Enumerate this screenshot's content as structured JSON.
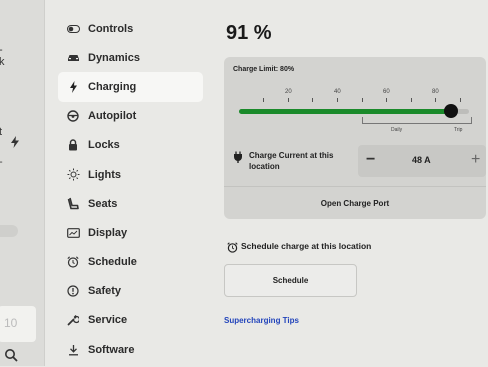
{
  "left_strip": {
    "frag1": "-",
    "frag2": "k",
    "frag3": "t",
    "frag4": "-",
    "tile_text": "10"
  },
  "menu": [
    {
      "label": "Controls",
      "icon": "toggle-icon",
      "active": false
    },
    {
      "label": "Dynamics",
      "icon": "car-icon",
      "active": false
    },
    {
      "label": "Charging",
      "icon": "bolt-icon",
      "active": true
    },
    {
      "label": "Autopilot",
      "icon": "steering-wheel-icon",
      "active": false
    },
    {
      "label": "Locks",
      "icon": "lock-icon",
      "active": false
    },
    {
      "label": "Lights",
      "icon": "sun-icon",
      "active": false
    },
    {
      "label": "Seats",
      "icon": "seat-icon",
      "active": false
    },
    {
      "label": "Display",
      "icon": "display-icon",
      "active": false
    },
    {
      "label": "Schedule",
      "icon": "alarm-clock-icon",
      "active": false
    },
    {
      "label": "Safety",
      "icon": "alert-circle-icon",
      "active": false
    },
    {
      "label": "Service",
      "icon": "wrench-icon",
      "active": false
    },
    {
      "label": "Software",
      "icon": "download-icon",
      "active": false
    }
  ],
  "charging": {
    "percent": "91 %",
    "charge_limit_label": "Charge Limit: 80%",
    "charge_limit_value": 80,
    "tick_labels": [
      "20",
      "40",
      "60",
      "80"
    ],
    "daily_label": "Daily",
    "trip_label": "Trip",
    "current_label": "Charge Current at this location",
    "current_value": "48 A",
    "minus": "−",
    "plus": "+",
    "open_port": "Open Charge Port"
  },
  "schedule": {
    "label": "Schedule charge at this location",
    "button": "Schedule"
  },
  "supercharging_tips": "Supercharging Tips",
  "colors": {
    "accent_green": "#1a8a2a",
    "link_blue": "#2244bb",
    "background": "#e9e9e6"
  }
}
